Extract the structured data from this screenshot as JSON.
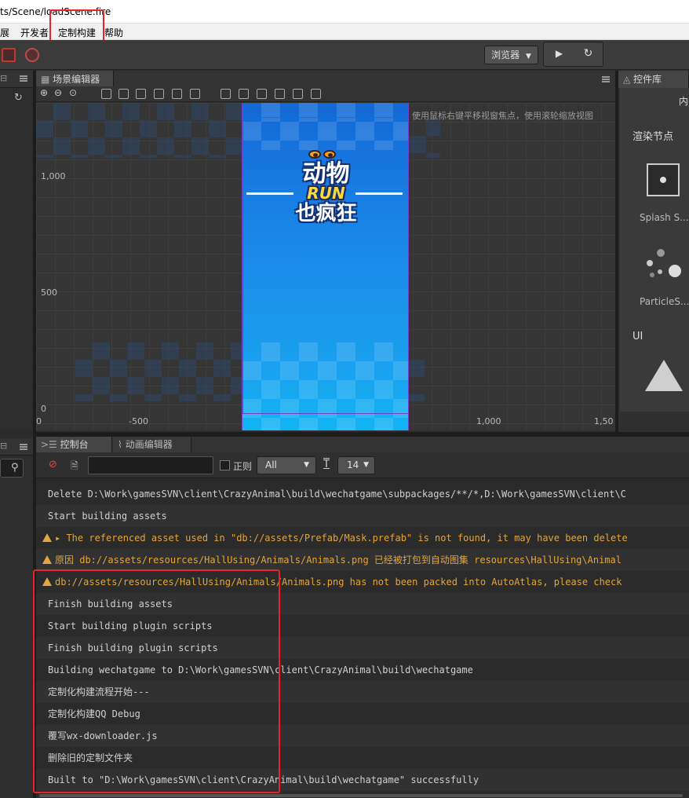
{
  "titlebar": {
    "title": "ts/Scene/loadScene.fire"
  },
  "menubar": {
    "items": [
      "展",
      "开发者",
      "定制构建",
      "帮助"
    ]
  },
  "toolbar": {
    "preview_select": "浏览器",
    "play_icon": "play-icon",
    "refresh_icon": "refresh-icon"
  },
  "scene_panel": {
    "tab": "场景编辑器",
    "hint": "使用鼠标右键平移视窗焦点，使用滚轮缩放视图",
    "y_ticks": [
      "1,000",
      "500",
      "0"
    ],
    "x_ticks": [
      "0",
      "-500",
      "1,000",
      "1,50"
    ],
    "logo": {
      "line1": "动物",
      "run": "RUN",
      "line2": "也疯狂"
    }
  },
  "library_panel": {
    "tab": "控件库",
    "top_text": "内",
    "section_render": "渲染节点",
    "items": [
      "Splash S...",
      "ParticleS..."
    ],
    "section_ui": "UI"
  },
  "console": {
    "tabs": [
      "控制台",
      "动画编辑器"
    ],
    "regex_label": "正则",
    "level_select": "All",
    "font_size": "14",
    "font_icon": "T",
    "rows": [
      {
        "text": "Delete D:\\Work\\gamesSVN\\client\\CrazyAnimal\\build\\wechatgame\\subpackages/**/*,D:\\Work\\gamesSVN\\client\\C",
        "level": "info"
      },
      {
        "text": "Start building assets",
        "level": "info"
      },
      {
        "text": "▸ The referenced asset used in \"db://assets/Prefab/Mask.prefab\" is not found, it may have been delete",
        "level": "warn"
      },
      {
        "text": "原因 db://assets/resources/HallUsing/Animals/Animals.png 已经被打包到自动图集 resources\\HallUsing\\Animal",
        "level": "warn"
      },
      {
        "text": "db://assets/resources/HallUsing/Animals/Animals.png has not been packed into AutoAtlas, please check",
        "level": "warn"
      },
      {
        "text": "Finish building assets",
        "level": "info"
      },
      {
        "text": "Start building plugin scripts",
        "level": "info"
      },
      {
        "text": "Finish building plugin scripts",
        "level": "info"
      },
      {
        "text": "Building wechatgame to D:\\Work\\gamesSVN\\client\\CrazyAnimal\\build\\wechatgame",
        "level": "info"
      },
      {
        "text": "定制化构建流程开始---",
        "level": "info"
      },
      {
        "text": "定制化构建QQ Debug",
        "level": "info"
      },
      {
        "text": "覆写wx-downloader.js",
        "level": "info"
      },
      {
        "text": "删除旧的定制文件夹",
        "level": "info"
      },
      {
        "text": "Built to \"D:\\Work\\gamesSVN\\client\\CrazyAnimal\\build\\wechatgame\" successfully",
        "level": "info"
      }
    ]
  }
}
